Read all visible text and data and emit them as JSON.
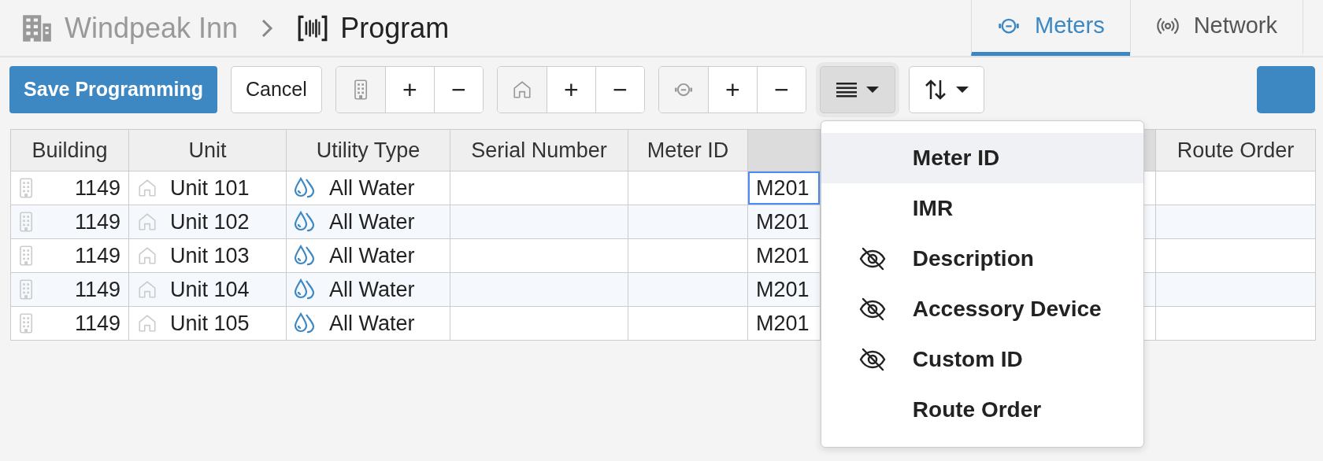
{
  "breadcrumb": [
    {
      "kind": "building",
      "text": "Windpeak Inn"
    },
    {
      "kind": "program",
      "text": "Program"
    }
  ],
  "tabs": [
    {
      "kind": "meter",
      "label": "Meters",
      "selected": true
    },
    {
      "kind": "network",
      "label": "Network",
      "selected": false
    }
  ],
  "toolbar": {
    "save": "Save Programming",
    "cancel": "Cancel",
    "groups": [
      {
        "kind": "building",
        "add": "+",
        "remove": "−"
      },
      {
        "kind": "unit",
        "add": "+",
        "remove": "−"
      },
      {
        "kind": "meter",
        "add": "+",
        "remove": "−"
      }
    ],
    "columns_menu": {
      "expanded": true
    },
    "sort_menu": {
      "expanded": false
    }
  },
  "table": {
    "columns": [
      {
        "label": "Building",
        "selected": false
      },
      {
        "label": "Unit",
        "selected": false
      },
      {
        "label": "Utility Type",
        "selected": false
      },
      {
        "label": "Serial Number",
        "selected": false
      },
      {
        "label": "Meter ID",
        "selected": false
      },
      {
        "selected": true
      },
      {
        "label": "Route Order",
        "selected": false
      }
    ],
    "rows": [
      {
        "building": "1149",
        "unit": "Unit 101",
        "utility_type": "All Water",
        "column_6": "M201",
        "focused": true
      },
      {
        "building": "1149",
        "unit": "Unit 102",
        "utility_type": "All Water",
        "column_6": "M201",
        "focused": false
      },
      {
        "building": "1149",
        "unit": "Unit 103",
        "utility_type": "All Water",
        "column_6": "M201",
        "focused": false
      },
      {
        "building": "1149",
        "unit": "Unit 104",
        "utility_type": "All Water",
        "column_6": "M201",
        "focused": false
      },
      {
        "building": "1149",
        "unit": "Unit 105",
        "utility_type": "All Water",
        "column_6": "M201",
        "focused": false
      }
    ]
  },
  "column_menu": {
    "items": [
      {
        "label": "Meter ID",
        "hidden": false,
        "highlighted": true
      },
      {
        "label": "IMR",
        "hidden": false,
        "highlighted": false
      },
      {
        "label": "Description",
        "hidden": true,
        "highlighted": false
      },
      {
        "label": "Accessory Device",
        "hidden": true,
        "highlighted": false
      },
      {
        "label": "Custom ID",
        "hidden": true,
        "highlighted": false
      },
      {
        "label": "Route Order",
        "hidden": false,
        "highlighted": false
      }
    ]
  }
}
